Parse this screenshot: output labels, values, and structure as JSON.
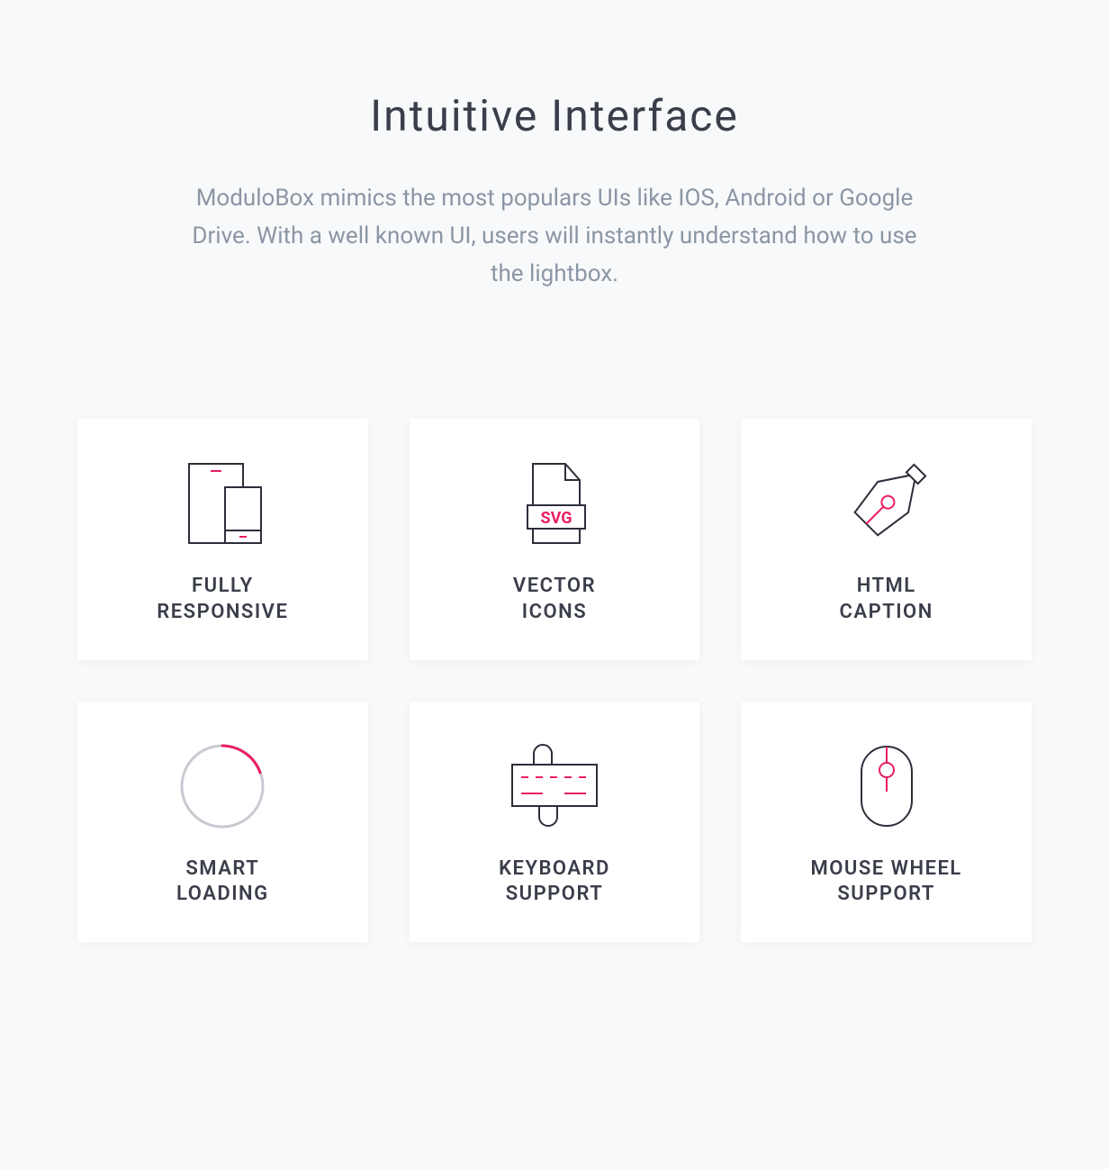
{
  "heading": "Intuitive Interface",
  "subheading": "ModuloBox mimics the most populars UIs like IOS, Android or Google Drive. With a well known UI, users will instantly understand how to use the lightbox.",
  "features": [
    {
      "icon": "devices-icon",
      "title": "FULLY\nRESPONSIVE"
    },
    {
      "icon": "svg-file-icon",
      "title": "VECTOR\nICONS",
      "badge": "SVG"
    },
    {
      "icon": "pen-nib-icon",
      "title": "HTML\nCAPTION"
    },
    {
      "icon": "spinner-icon",
      "title": "SMART\nLOADING"
    },
    {
      "icon": "keyboard-icon",
      "title": "KEYBOARD\nSUPPORT"
    },
    {
      "icon": "mouse-icon",
      "title": "MOUSE WHEEL\nSUPPORT"
    }
  ],
  "colors": {
    "accent": "#e91e63",
    "stroke": "#2c2f3a",
    "muted": "#8b96a5",
    "bg": "#f8f9fa",
    "card": "#ffffff"
  }
}
